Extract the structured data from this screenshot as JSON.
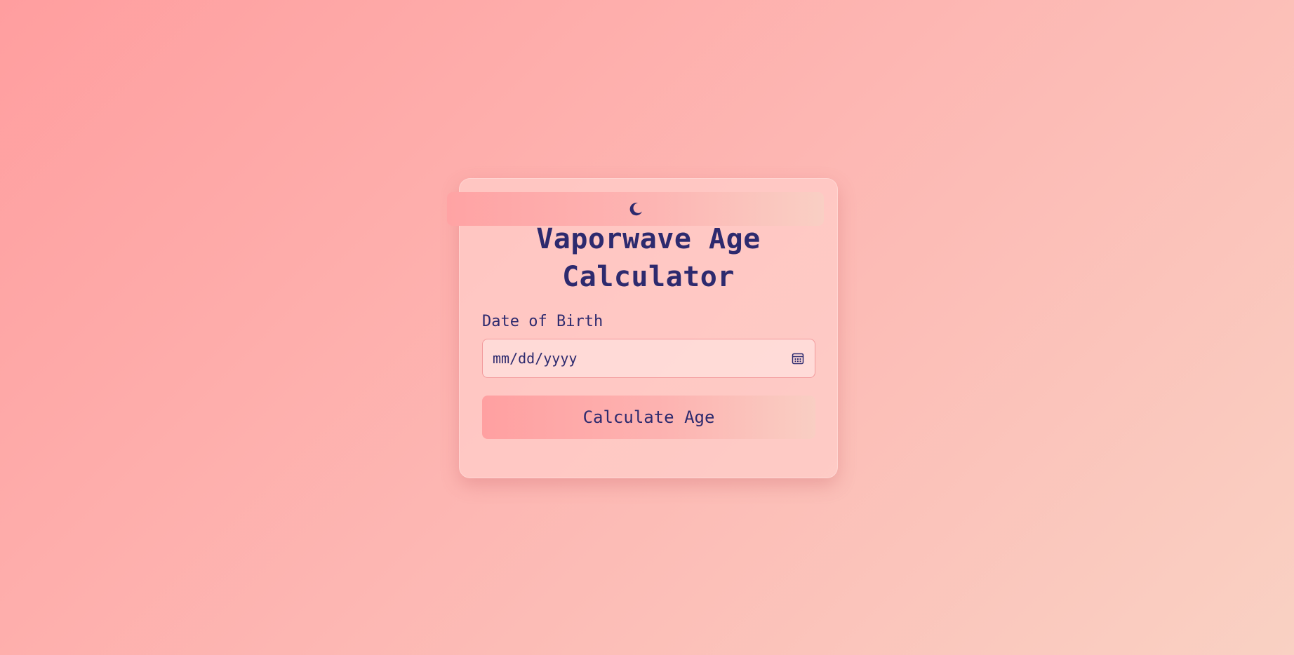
{
  "theme_toggle": {
    "icon": "moon-icon"
  },
  "card": {
    "title": "Vaporwave Age Calculator",
    "dob_label": "Date of Birth",
    "date_input": {
      "placeholder": "mm/dd/yyyy",
      "icon": "calendar-icon"
    },
    "calculate_button": "Calculate Age"
  },
  "colors": {
    "text": "#2d2a6e",
    "background_start": "#ff9e9f",
    "background_end": "#f9d1c3",
    "input_border": "#f29a9c"
  }
}
